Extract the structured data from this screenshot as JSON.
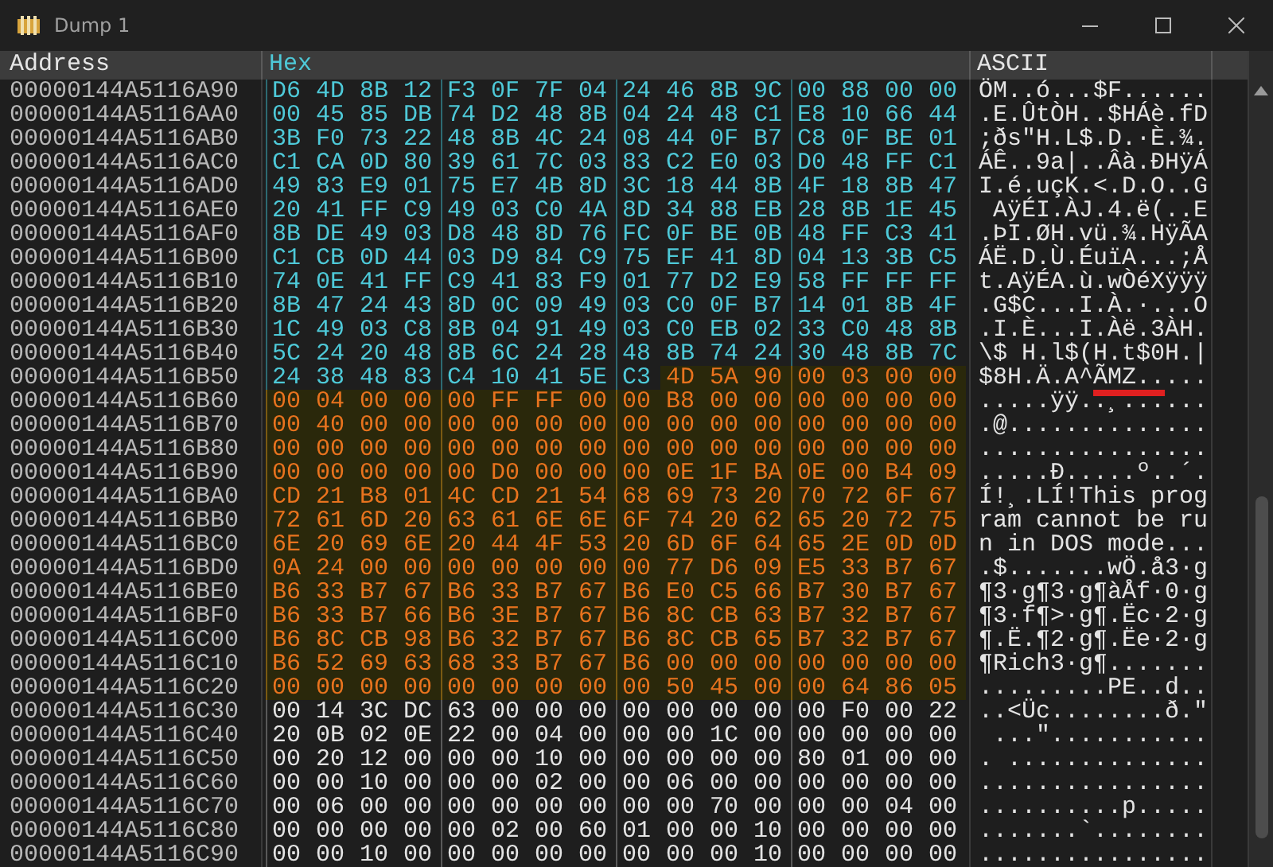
{
  "window": {
    "title": "Dump 1"
  },
  "headers": [
    {
      "label": "Address",
      "kind": "address"
    },
    {
      "label": "Hex",
      "kind": "hex"
    },
    {
      "label": "ASCII",
      "kind": "ascii"
    }
  ],
  "rows": [
    {
      "address": "00000144A5116A90",
      "segments": [
        {
          "kind": "code",
          "bytes": [
            "D6",
            "4D",
            "8B",
            "12",
            "F3",
            "0F",
            "7F",
            "04",
            "24",
            "46",
            "8B",
            "9C",
            "00",
            "88",
            "00",
            "00"
          ]
        }
      ],
      "ascii": [
        {
          "text": "ÖM..ó...$F......",
          "marked": false
        }
      ]
    },
    {
      "address": "00000144A5116AA0",
      "segments": [
        {
          "kind": "code",
          "bytes": [
            "00",
            "45",
            "85",
            "DB",
            "74",
            "D2",
            "48",
            "8B",
            "04",
            "24",
            "48",
            "C1",
            "E8",
            "10",
            "66",
            "44"
          ]
        }
      ],
      "ascii": [
        {
          "text": ".E.ÛtÒH..$HÁè.fD",
          "marked": false
        }
      ]
    },
    {
      "address": "00000144A5116AB0",
      "segments": [
        {
          "kind": "code",
          "bytes": [
            "3B",
            "F0",
            "73",
            "22",
            "48",
            "8B",
            "4C",
            "24",
            "08",
            "44",
            "0F",
            "B7",
            "C8",
            "0F",
            "BE",
            "01"
          ]
        }
      ],
      "ascii": [
        {
          "text": ";ðs\"H.L$.D.·È.¾.",
          "marked": false
        }
      ]
    },
    {
      "address": "00000144A5116AC0",
      "segments": [
        {
          "kind": "code",
          "bytes": [
            "C1",
            "CA",
            "0D",
            "80",
            "39",
            "61",
            "7C",
            "03",
            "83",
            "C2",
            "E0",
            "03",
            "D0",
            "48",
            "FF",
            "C1"
          ]
        }
      ],
      "ascii": [
        {
          "text": "ÁÊ..9a|..Âà.ÐHÿÁ",
          "marked": false
        }
      ]
    },
    {
      "address": "00000144A5116AD0",
      "segments": [
        {
          "kind": "code",
          "bytes": [
            "49",
            "83",
            "E9",
            "01",
            "75",
            "E7",
            "4B",
            "8D",
            "3C",
            "18",
            "44",
            "8B",
            "4F",
            "18",
            "8B",
            "47"
          ]
        }
      ],
      "ascii": [
        {
          "text": "I.é.uçK.<.D.O..G",
          "marked": false
        }
      ]
    },
    {
      "address": "00000144A5116AE0",
      "segments": [
        {
          "kind": "code",
          "bytes": [
            "20",
            "41",
            "FF",
            "C9",
            "49",
            "03",
            "C0",
            "4A",
            "8D",
            "34",
            "88",
            "EB",
            "28",
            "8B",
            "1E",
            "45"
          ]
        }
      ],
      "ascii": [
        {
          "text": " AÿÉI.ÀJ.4.ë(..E",
          "marked": false
        }
      ]
    },
    {
      "address": "00000144A5116AF0",
      "segments": [
        {
          "kind": "code",
          "bytes": [
            "8B",
            "DE",
            "49",
            "03",
            "D8",
            "48",
            "8D",
            "76",
            "FC",
            "0F",
            "BE",
            "0B",
            "48",
            "FF",
            "C3",
            "41"
          ]
        }
      ],
      "ascii": [
        {
          "text": ".ÞI.ØH.vü.¾.HÿÃA",
          "marked": false
        }
      ]
    },
    {
      "address": "00000144A5116B00",
      "segments": [
        {
          "kind": "code",
          "bytes": [
            "C1",
            "CB",
            "0D",
            "44",
            "03",
            "D9",
            "84",
            "C9",
            "75",
            "EF",
            "41",
            "8D",
            "04",
            "13",
            "3B",
            "C5"
          ]
        }
      ],
      "ascii": [
        {
          "text": "ÁË.D.Ù.ÉuïA...;Å",
          "marked": false
        }
      ]
    },
    {
      "address": "00000144A5116B10",
      "segments": [
        {
          "kind": "code",
          "bytes": [
            "74",
            "0E",
            "41",
            "FF",
            "C9",
            "41",
            "83",
            "F9",
            "01",
            "77",
            "D2",
            "E9",
            "58",
            "FF",
            "FF",
            "FF"
          ]
        }
      ],
      "ascii": [
        {
          "text": "t.AÿÉA.ù.wÒéXÿÿÿ",
          "marked": false
        }
      ]
    },
    {
      "address": "00000144A5116B20",
      "segments": [
        {
          "kind": "code",
          "bytes": [
            "8B",
            "47",
            "24",
            "43",
            "8D",
            "0C",
            "09",
            "49",
            "03",
            "C0",
            "0F",
            "B7",
            "14",
            "01",
            "8B",
            "4F"
          ]
        }
      ],
      "ascii": [
        {
          "text": ".G$C...I.À.·...O",
          "marked": false
        }
      ]
    },
    {
      "address": "00000144A5116B30",
      "segments": [
        {
          "kind": "code",
          "bytes": [
            "1C",
            "49",
            "03",
            "C8",
            "8B",
            "04",
            "91",
            "49",
            "03",
            "C0",
            "EB",
            "02",
            "33",
            "C0",
            "48",
            "8B"
          ]
        }
      ],
      "ascii": [
        {
          "text": ".I.È...I.Àë.3ÀH.",
          "marked": false
        }
      ]
    },
    {
      "address": "00000144A5116B40",
      "segments": [
        {
          "kind": "code",
          "bytes": [
            "5C",
            "24",
            "20",
            "48",
            "8B",
            "6C",
            "24",
            "28",
            "48",
            "8B",
            "74",
            "24",
            "30",
            "48",
            "8B",
            "7C"
          ]
        }
      ],
      "ascii": [
        {
          "text": "\\$ H.l$(H.t$0H.|",
          "marked": false
        }
      ]
    },
    {
      "address": "00000144A5116B50",
      "segments": [
        {
          "kind": "code",
          "bytes": [
            "24",
            "38",
            "48",
            "83",
            "C4",
            "10",
            "41",
            "5E",
            "C3"
          ]
        },
        {
          "kind": "selected",
          "bytes": [
            "4D",
            "5A",
            "90",
            "00",
            "03",
            "00",
            "00"
          ]
        }
      ],
      "ascii": [
        {
          "text": "$8H.Ä.A^",
          "marked": false
        },
        {
          "text": "ÃMZ..",
          "marked": true
        },
        {
          "text": "...",
          "marked": false
        }
      ]
    },
    {
      "address": "00000144A5116B60",
      "segments": [
        {
          "kind": "selected",
          "bytes": [
            "00",
            "04",
            "00",
            "00",
            "00",
            "FF",
            "FF",
            "00",
            "00",
            "B8",
            "00",
            "00",
            "00",
            "00",
            "00",
            "00"
          ]
        }
      ],
      "ascii": [
        {
          "text": ".....ÿÿ..¸......",
          "marked": false
        }
      ]
    },
    {
      "address": "00000144A5116B70",
      "segments": [
        {
          "kind": "selected",
          "bytes": [
            "00",
            "40",
            "00",
            "00",
            "00",
            "00",
            "00",
            "00",
            "00",
            "00",
            "00",
            "00",
            "00",
            "00",
            "00",
            "00"
          ]
        }
      ],
      "ascii": [
        {
          "text": ".@..............",
          "marked": false
        }
      ]
    },
    {
      "address": "00000144A5116B80",
      "segments": [
        {
          "kind": "selected",
          "bytes": [
            "00",
            "00",
            "00",
            "00",
            "00",
            "00",
            "00",
            "00",
            "00",
            "00",
            "00",
            "00",
            "00",
            "00",
            "00",
            "00"
          ]
        }
      ],
      "ascii": [
        {
          "text": "................",
          "marked": false
        }
      ]
    },
    {
      "address": "00000144A5116B90",
      "segments": [
        {
          "kind": "selected",
          "bytes": [
            "00",
            "00",
            "00",
            "00",
            "00",
            "D0",
            "00",
            "00",
            "00",
            "0E",
            "1F",
            "BA",
            "0E",
            "00",
            "B4",
            "09"
          ]
        }
      ],
      "ascii": [
        {
          "text": ".....Ð.....º..´.",
          "marked": false
        }
      ]
    },
    {
      "address": "00000144A5116BA0",
      "segments": [
        {
          "kind": "selected",
          "bytes": [
            "CD",
            "21",
            "B8",
            "01",
            "4C",
            "CD",
            "21",
            "54",
            "68",
            "69",
            "73",
            "20",
            "70",
            "72",
            "6F",
            "67"
          ]
        }
      ],
      "ascii": [
        {
          "text": "Í!¸.LÍ!This prog",
          "marked": false
        }
      ]
    },
    {
      "address": "00000144A5116BB0",
      "segments": [
        {
          "kind": "selected",
          "bytes": [
            "72",
            "61",
            "6D",
            "20",
            "63",
            "61",
            "6E",
            "6E",
            "6F",
            "74",
            "20",
            "62",
            "65",
            "20",
            "72",
            "75"
          ]
        }
      ],
      "ascii": [
        {
          "text": "ram cannot be ru",
          "marked": false
        }
      ]
    },
    {
      "address": "00000144A5116BC0",
      "segments": [
        {
          "kind": "selected",
          "bytes": [
            "6E",
            "20",
            "69",
            "6E",
            "20",
            "44",
            "4F",
            "53",
            "20",
            "6D",
            "6F",
            "64",
            "65",
            "2E",
            "0D",
            "0D"
          ]
        }
      ],
      "ascii": [
        {
          "text": "n in DOS mode...",
          "marked": false
        }
      ]
    },
    {
      "address": "00000144A5116BD0",
      "segments": [
        {
          "kind": "selected",
          "bytes": [
            "0A",
            "24",
            "00",
            "00",
            "00",
            "00",
            "00",
            "00",
            "00",
            "77",
            "D6",
            "09",
            "E5",
            "33",
            "B7",
            "67"
          ]
        }
      ],
      "ascii": [
        {
          "text": ".$.......wÖ.å3·g",
          "marked": false
        }
      ]
    },
    {
      "address": "00000144A5116BE0",
      "segments": [
        {
          "kind": "selected",
          "bytes": [
            "B6",
            "33",
            "B7",
            "67",
            "B6",
            "33",
            "B7",
            "67",
            "B6",
            "E0",
            "C5",
            "66",
            "B7",
            "30",
            "B7",
            "67"
          ]
        }
      ],
      "ascii": [
        {
          "text": "¶3·g¶3·g¶àÅf·0·g",
          "marked": false
        }
      ]
    },
    {
      "address": "00000144A5116BF0",
      "segments": [
        {
          "kind": "selected",
          "bytes": [
            "B6",
            "33",
            "B7",
            "66",
            "B6",
            "3E",
            "B7",
            "67",
            "B6",
            "8C",
            "CB",
            "63",
            "B7",
            "32",
            "B7",
            "67"
          ]
        }
      ],
      "ascii": [
        {
          "text": "¶3·f¶>·g¶.Ëc·2·g",
          "marked": false
        }
      ]
    },
    {
      "address": "00000144A5116C00",
      "segments": [
        {
          "kind": "selected",
          "bytes": [
            "B6",
            "8C",
            "CB",
            "98",
            "B6",
            "32",
            "B7",
            "67",
            "B6",
            "8C",
            "CB",
            "65",
            "B7",
            "32",
            "B7",
            "67"
          ]
        }
      ],
      "ascii": [
        {
          "text": "¶.Ë.¶2·g¶.Ëe·2·g",
          "marked": false
        }
      ]
    },
    {
      "address": "00000144A5116C10",
      "segments": [
        {
          "kind": "selected",
          "bytes": [
            "B6",
            "52",
            "69",
            "63",
            "68",
            "33",
            "B7",
            "67",
            "B6",
            "00",
            "00",
            "00",
            "00",
            "00",
            "00",
            "00"
          ]
        }
      ],
      "ascii": [
        {
          "text": "¶Rich3·g¶.......",
          "marked": false
        }
      ]
    },
    {
      "address": "00000144A5116C20",
      "segments": [
        {
          "kind": "selected",
          "bytes": [
            "00",
            "00",
            "00",
            "00",
            "00",
            "00",
            "00",
            "00",
            "00",
            "50",
            "45",
            "00",
            "00",
            "64",
            "86",
            "05"
          ]
        }
      ],
      "ascii": [
        {
          "text": ".........PE..d..",
          "marked": false
        }
      ]
    },
    {
      "address": "00000144A5116C30",
      "segments": [
        {
          "kind": "data",
          "bytes": [
            "00",
            "14",
            "3C",
            "DC",
            "63",
            "00",
            "00",
            "00",
            "00",
            "00",
            "00",
            "00",
            "00",
            "F0",
            "00",
            "22"
          ]
        }
      ],
      "ascii": [
        {
          "text": "..<Üc........ð.\"",
          "marked": false
        }
      ]
    },
    {
      "address": "00000144A5116C40",
      "segments": [
        {
          "kind": "data",
          "bytes": [
            "20",
            "0B",
            "02",
            "0E",
            "22",
            "00",
            "04",
            "00",
            "00",
            "00",
            "1C",
            "00",
            "00",
            "00",
            "00",
            "00"
          ]
        }
      ],
      "ascii": [
        {
          "text": " ...\"...........",
          "marked": false
        }
      ]
    },
    {
      "address": "00000144A5116C50",
      "segments": [
        {
          "kind": "data",
          "bytes": [
            "00",
            "20",
            "12",
            "00",
            "00",
            "00",
            "10",
            "00",
            "00",
            "00",
            "00",
            "00",
            "80",
            "01",
            "00",
            "00"
          ]
        }
      ],
      "ascii": [
        {
          "text": ". ..............",
          "marked": false
        }
      ]
    },
    {
      "address": "00000144A5116C60",
      "segments": [
        {
          "kind": "data",
          "bytes": [
            "00",
            "00",
            "10",
            "00",
            "00",
            "00",
            "02",
            "00",
            "00",
            "06",
            "00",
            "00",
            "00",
            "00",
            "00",
            "00"
          ]
        }
      ],
      "ascii": [
        {
          "text": "................",
          "marked": false
        }
      ]
    },
    {
      "address": "00000144A5116C70",
      "segments": [
        {
          "kind": "data",
          "bytes": [
            "00",
            "06",
            "00",
            "00",
            "00",
            "00",
            "00",
            "00",
            "00",
            "00",
            "70",
            "00",
            "00",
            "00",
            "04",
            "00"
          ]
        }
      ],
      "ascii": [
        {
          "text": "..........p.....",
          "marked": false
        }
      ]
    },
    {
      "address": "00000144A5116C80",
      "segments": [
        {
          "kind": "data",
          "bytes": [
            "00",
            "00",
            "00",
            "00",
            "00",
            "02",
            "00",
            "60",
            "01",
            "00",
            "00",
            "10",
            "00",
            "00",
            "00",
            "00"
          ]
        }
      ],
      "ascii": [
        {
          "text": ".......`........",
          "marked": false
        }
      ]
    },
    {
      "address": "00000144A5116C90",
      "segments": [
        {
          "kind": "data",
          "bytes": [
            "00",
            "00",
            "10",
            "00",
            "00",
            "00",
            "00",
            "00",
            "00",
            "00",
            "00",
            "10",
            "00",
            "00",
            "00",
            "00"
          ]
        }
      ],
      "ascii": [
        {
          "text": "................",
          "marked": false
        }
      ]
    }
  ]
}
